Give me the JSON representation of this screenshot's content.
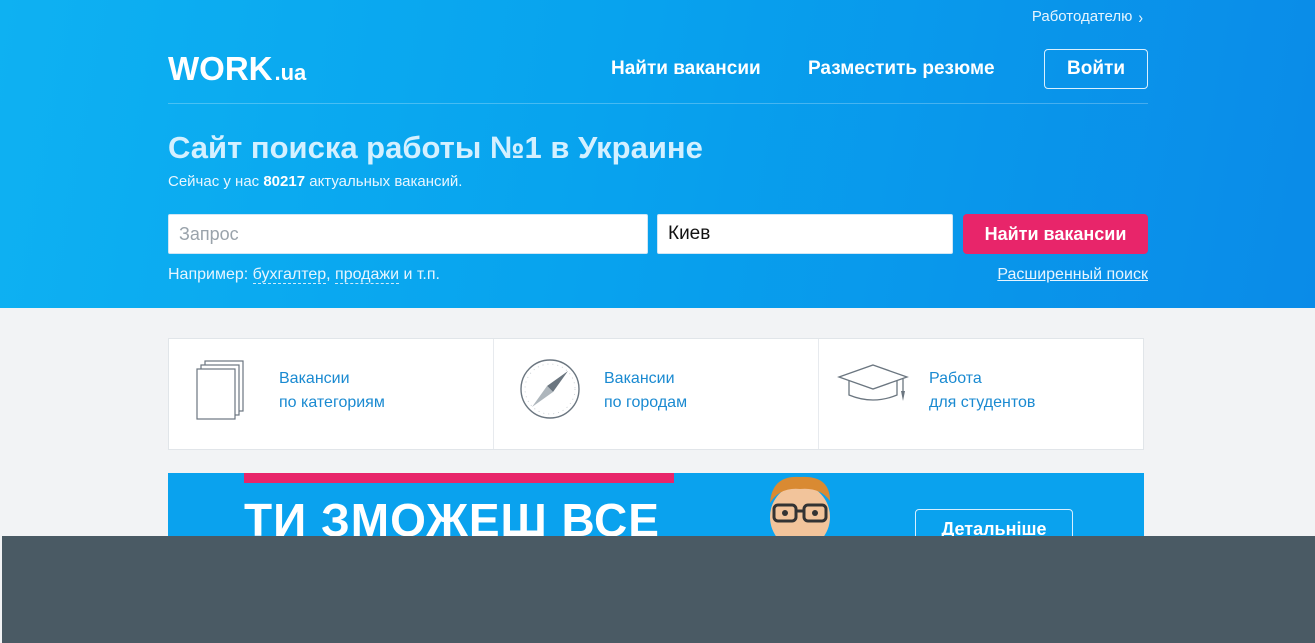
{
  "header": {
    "employer_link": "Работодателю",
    "logo": {
      "main": "WORK",
      "suffix": ".ua"
    },
    "nav": {
      "find_jobs": "Найти вакансии",
      "post_resume": "Разместить резюме",
      "login": "Войти"
    }
  },
  "hero": {
    "title": "Сайт поиска работы №1 в Украине",
    "subtitle_prefix": "Сейчас у нас",
    "vacancy_count": "80217",
    "subtitle_suffix": "актуальных вакансий."
  },
  "search": {
    "query_placeholder": "Запрос",
    "query_value": "",
    "city_value": "Киев",
    "submit_label": "Найти вакансии",
    "examples_prefix": "Например:",
    "example_1": "бухгалтер",
    "example_2": "продажи",
    "examples_suffix": "и т.п.",
    "advanced_link": "Расширенный поиск"
  },
  "quick_links": [
    {
      "line1": "Вакансии",
      "line2": "по категориям",
      "icon": "documents-icon"
    },
    {
      "line1": "Вакансии",
      "line2": "по городам",
      "icon": "compass-icon"
    },
    {
      "line1": "Работа",
      "line2": "для студентов",
      "icon": "graduation-cap-icon"
    }
  ],
  "banner": {
    "slogan": "ТИ ЗМОЖЕШ ВСЕ",
    "button": "Детальніше"
  },
  "colors": {
    "hero_blue": "#0aa2ee",
    "accent_pink": "#e8256a",
    "link_blue": "#1a8ad1",
    "overlay": "#4a5a64"
  }
}
